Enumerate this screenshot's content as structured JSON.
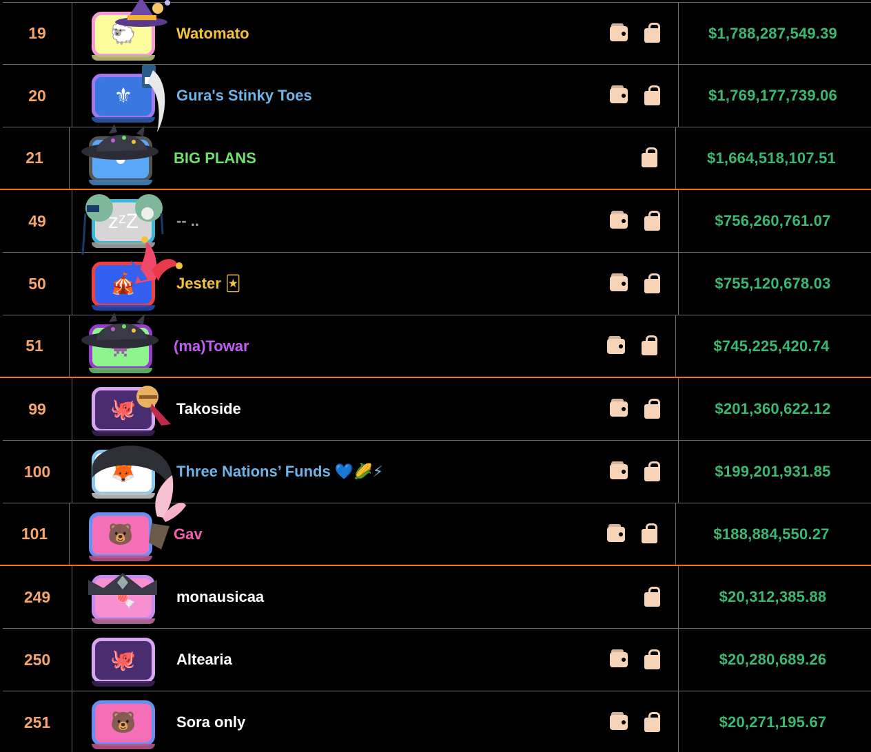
{
  "leaderboard": {
    "rows": [
      {
        "rank": "19",
        "name": "Watomato",
        "name_color": "#f5c338",
        "value": "$1,788,287,549.39",
        "has_wallet": true,
        "has_bag": true,
        "avatar": {
          "icon": "sheep-icon",
          "glyph": "🐑",
          "bg": "#fdfd9e",
          "border": "#f69bd8"
        },
        "hat": "witch-hat-icon"
      },
      {
        "rank": "20",
        "name": "Gura's Stinky Toes",
        "name_color": "#6fb4e6",
        "value": "$1,769,177,739.06",
        "has_wallet": true,
        "has_bag": true,
        "avatar": {
          "icon": "trident-emblem-icon",
          "glyph": "⚜",
          "bg": "#3a77e0",
          "border": "#a678f0"
        },
        "hat": "feather-hat-icon"
      },
      {
        "rank": "21",
        "name": "BIG PLANS",
        "name_color": "#6ee06e",
        "value": "$1,664,518,107.51",
        "has_wallet": false,
        "has_bag": true,
        "avatar": {
          "icon": "planet-icon",
          "glyph": "●",
          "bg": "#5aa8f5",
          "border": "#555"
        },
        "hat": "demon-hat-icon"
      },
      {
        "rank": "49",
        "name": "-- ..",
        "name_color": "#9aa0a8",
        "value": "$756,260,761.07",
        "has_wallet": true,
        "has_bag": true,
        "avatar": {
          "icon": "sleep-zzz-icon",
          "glyph": "zᶻZ",
          "bg": "#d6d6d6",
          "border": "#39b8d8"
        },
        "hat": "bun-hair-icon"
      },
      {
        "rank": "50",
        "name": "Jester 🃏",
        "name_color": "#f5c338",
        "value": "$755,120,678.03",
        "has_wallet": true,
        "has_bag": true,
        "avatar": {
          "icon": "circus-tent-icon",
          "glyph": "🎪",
          "bg": "#3360f0",
          "border": "#f04040"
        },
        "hat": "jester-hat-icon"
      },
      {
        "rank": "51",
        "name": "(ma)Towar",
        "name_color": "#c15ff0",
        "value": "$745,225,420.74",
        "has_wallet": true,
        "has_bag": true,
        "avatar": {
          "icon": "pixel-invader-icon",
          "glyph": "👾",
          "bg": "#8ef58e",
          "border": "#9a3ad0"
        },
        "hat": "demon-hat-icon"
      },
      {
        "rank": "99",
        "name": "Takoside",
        "name_color": "#ffffff",
        "value": "$201,360,622.12",
        "has_wallet": true,
        "has_bag": true,
        "avatar": {
          "icon": "octopus-icon",
          "glyph": "🐙",
          "bg": "#4a2c70",
          "border": "#d7a6f0"
        },
        "hat": "bell-ribbon-icon"
      },
      {
        "rank": "100",
        "name": "Three Nations’ Funds 💙🌽⚡",
        "name_color": "#6fb4e6",
        "value": "$199,201,931.85",
        "has_wallet": true,
        "has_bag": true,
        "avatar": {
          "icon": "fox-icon",
          "glyph": "🦊",
          "bg": "#ffffff",
          "border": "#8ac8ee"
        },
        "hat": "hood-icon"
      },
      {
        "rank": "101",
        "name": "Gav",
        "name_color": "#f060b0",
        "value": "$188,884,550.27",
        "has_wallet": true,
        "has_bag": true,
        "avatar": {
          "icon": "bear-icon",
          "glyph": "🐻",
          "bg": "#f46fb8",
          "border": "#6890f0"
        },
        "hat": "bow-icon"
      },
      {
        "rank": "249",
        "name": "monausicaa",
        "name_color": "#ffffff",
        "value": "$20,312,385.88",
        "has_wallet": false,
        "has_bag": true,
        "avatar": {
          "icon": "candy-icon",
          "glyph": "🍬",
          "bg": "#f790d0",
          "border": "#c88cf0"
        },
        "hat": "tiara-icon"
      },
      {
        "rank": "250",
        "name": "Altearia",
        "name_color": "#ffffff",
        "value": "$20,280,689.26",
        "has_wallet": true,
        "has_bag": true,
        "avatar": {
          "icon": "octopus-icon",
          "glyph": "🐙",
          "bg": "#4a2c70",
          "border": "#d7a6f0"
        },
        "hat": ""
      },
      {
        "rank": "251",
        "name": "Sora only",
        "name_color": "#ffffff",
        "value": "$20,271,195.67",
        "has_wallet": true,
        "has_bag": true,
        "avatar": {
          "icon": "bear-icon",
          "glyph": "🐻",
          "bg": "#f46fb8",
          "border": "#6890f0"
        },
        "hat": ""
      }
    ]
  }
}
